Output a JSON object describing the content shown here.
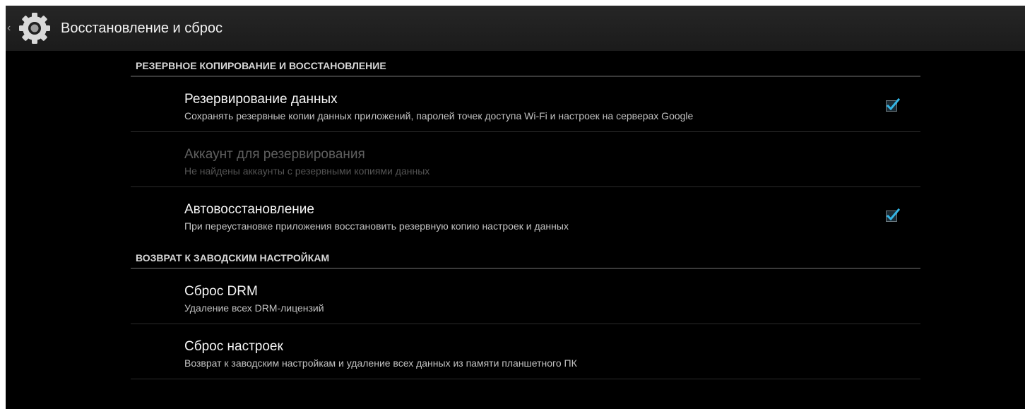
{
  "action_bar": {
    "title": "Восстановление и сброс",
    "up_icon": "chevron-left-icon",
    "app_icon": "settings-gear-icon"
  },
  "sections": [
    {
      "header": "РЕЗЕРВНОЕ КОПИРОВАНИЕ И ВОССТАНОВЛЕНИЕ",
      "items": [
        {
          "title": "Резервирование данных",
          "summary": "Сохранять резервные копии данных приложений, паролей точек доступа Wi-Fi и настроек на серверах Google",
          "checkbox": true,
          "checked": true,
          "enabled": true
        },
        {
          "title": "Аккаунт для резервирования",
          "summary": "Не найдены аккаунты с резервными копиями данных",
          "checkbox": false,
          "enabled": false
        },
        {
          "title": "Автовосстановление",
          "summary": "При переустановке приложения восстановить резервную копию настроек и данных",
          "checkbox": true,
          "checked": true,
          "enabled": true
        }
      ]
    },
    {
      "header": "ВОЗВРАТ К ЗАВОДСКИМ НАСТРОЙКАМ",
      "items": [
        {
          "title": "Сброс DRM",
          "summary": "Удаление всех DRM-лицензий",
          "checkbox": false,
          "enabled": true
        },
        {
          "title": "Сброс настроек",
          "summary": "Возврат к заводским настройкам и удаление всех данных из памяти планшетного ПК",
          "checkbox": false,
          "enabled": true
        }
      ]
    }
  ],
  "colors": {
    "background": "#000000",
    "action_bar": "#1f1f1f",
    "checkbox_accent": "#33b5e5",
    "divider": "#2b2b2b"
  }
}
